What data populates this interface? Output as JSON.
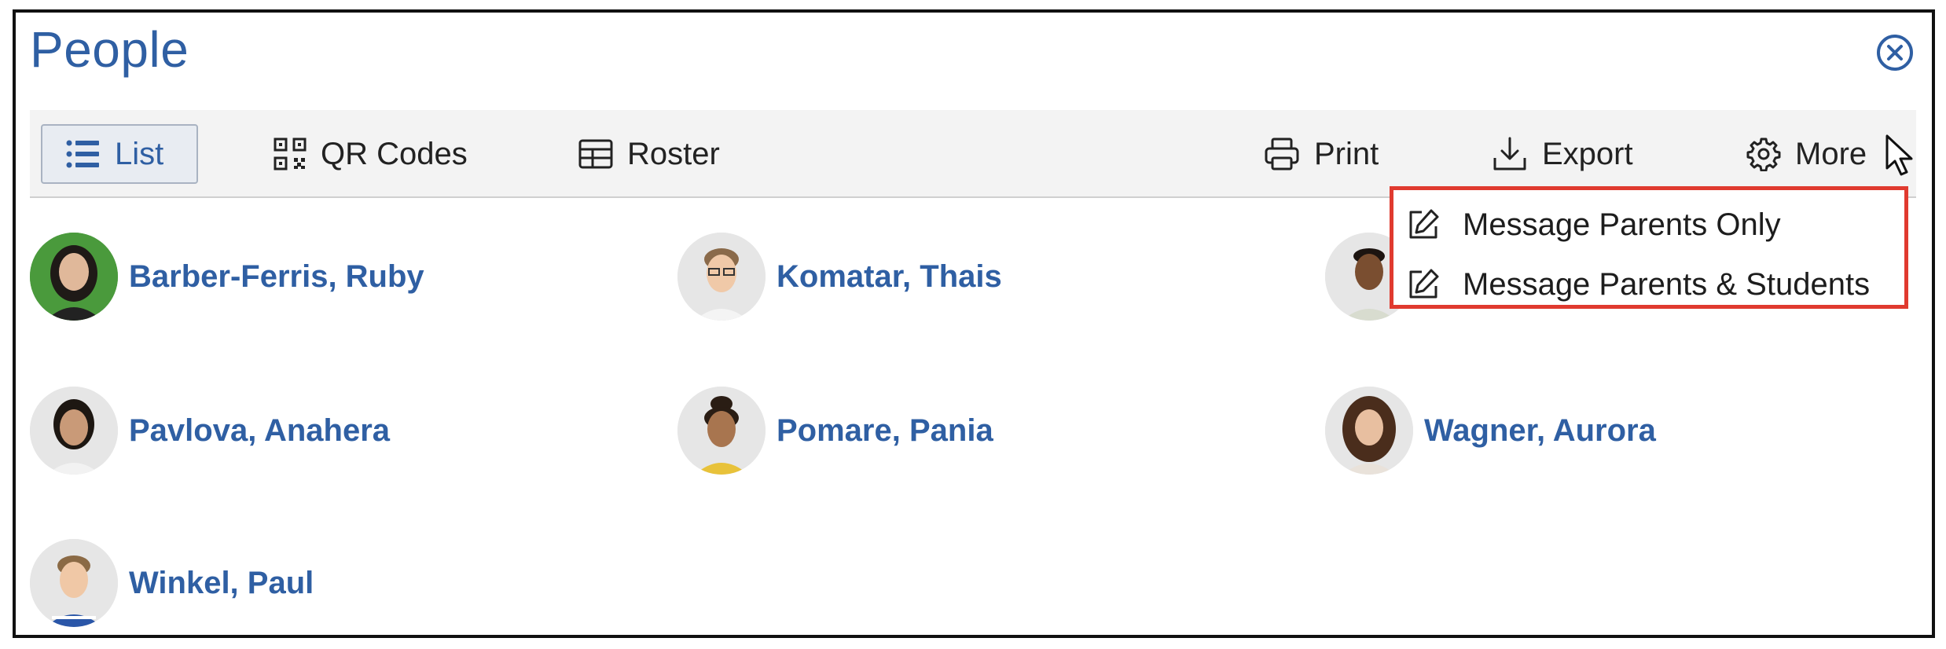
{
  "header": {
    "title": "People"
  },
  "toolbar": {
    "list_label": "List",
    "qr_label": "QR Codes",
    "roster_label": "Roster",
    "print_label": "Print",
    "export_label": "Export",
    "more_label": "More"
  },
  "more_menu": {
    "items": [
      {
        "label": "Message Parents Only"
      },
      {
        "label": "Message Parents & Students"
      }
    ]
  },
  "people": [
    {
      "name": "Barber-Ferris, Ruby"
    },
    {
      "name": "Komatar, Thais"
    },
    {
      "name": ""
    },
    {
      "name": "Pavlova, Anahera"
    },
    {
      "name": "Pomare, Pania"
    },
    {
      "name": "Wagner, Aurora"
    },
    {
      "name": "Winkel, Paul"
    }
  ],
  "colors": {
    "accent": "#2f5fa3",
    "highlight_border": "#e03a2f",
    "toolbar_bg": "#f3f3f3"
  },
  "icons": {
    "close": "close-circle-icon",
    "list": "list-icon",
    "qr": "qr-code-icon",
    "roster": "table-icon",
    "print": "printer-icon",
    "export": "download-icon",
    "more": "gear-icon",
    "menu_item": "pencil-edit-icon"
  }
}
